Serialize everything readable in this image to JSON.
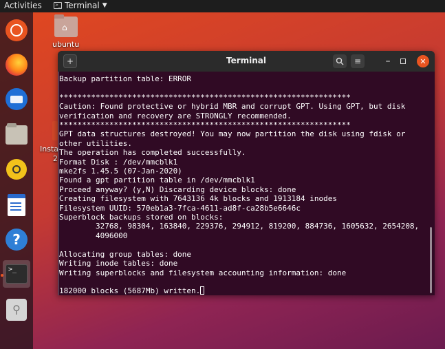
{
  "topbar": {
    "activities": "Activities",
    "app_name": "Terminal"
  },
  "desktop": {
    "home_label": "ubuntu",
    "installer_label": "Insta",
    "installer_label2": "2"
  },
  "dock": {
    "items": [
      "ubuntu-logo",
      "firefox",
      "thunderbird",
      "files",
      "rhythmbox",
      "libreoffice-writer",
      "help",
      "terminal",
      "usb-creator"
    ]
  },
  "terminal": {
    "title": "Terminal",
    "lines": [
      "Backup partition table: ERROR",
      "",
      "****************************************************************",
      "Caution: Found protective or hybrid MBR and corrupt GPT. Using GPT, but disk",
      "verification and recovery are STRONGLY recommended.",
      "****************************************************************",
      "GPT data structures destroyed! You may now partition the disk using fdisk or",
      "other utilities.",
      "The operation has completed successfully.",
      "Format Disk : /dev/mmcblk1",
      "mke2fs 1.45.5 (07-Jan-2020)",
      "Found a gpt partition table in /dev/mmcblk1",
      "Proceed anyway? (y,N) Discarding device blocks: done",
      "Creating filesystem with 7643136 4k blocks and 1913184 inodes",
      "Filesystem UUID: 570eb1a3-7fca-4611-ad8f-ca28b5e6646c",
      "Superblock backups stored on blocks:",
      "        32768, 98304, 163840, 229376, 294912, 819200, 884736, 1605632, 2654208,",
      "        4096000",
      "",
      "Allocating group tables: done",
      "Writing inode tables: done",
      "Writing superblocks and filesystem accounting information: done",
      "",
      "182000 blocks (5687Mb) written."
    ]
  }
}
